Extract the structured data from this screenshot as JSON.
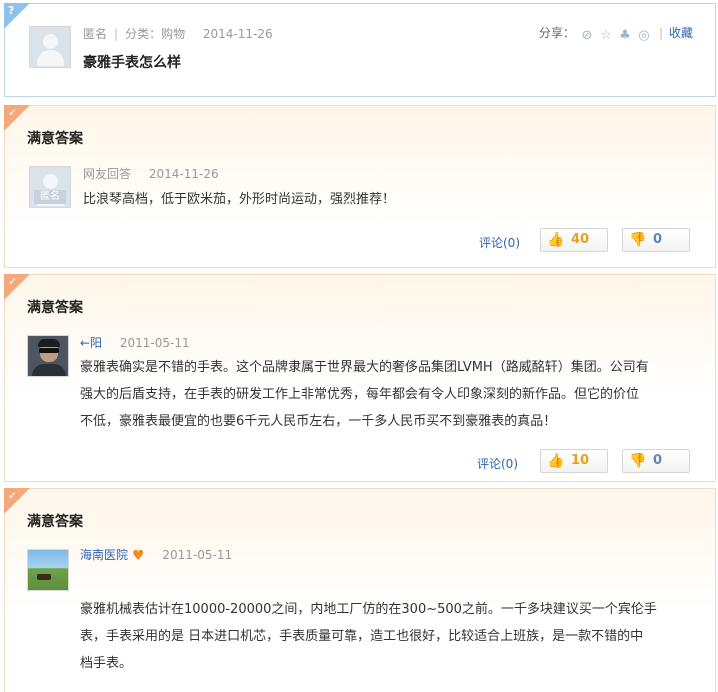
{
  "question": {
    "user": "匿名",
    "category": "分类：购物",
    "date": "2014-11-26",
    "title": "豪雅手表怎么样",
    "share_label": "分享：",
    "favorite_label": "收藏",
    "share_icons": [
      "search-icon",
      "star-icon",
      "user-icon",
      "weibo-icon"
    ]
  },
  "answers": [
    {
      "header": "满意答案",
      "user": "网友回答",
      "date": "2014-11-26",
      "avatar_tag": "匿名",
      "lines": [
        "比浪琴高档，低于欧米茄，外形时尚运动，强烈推荐！"
      ],
      "comment": "评论(0)",
      "up": "40",
      "down": "0"
    },
    {
      "header": "满意答案",
      "user": "←阳",
      "date": "2011-05-11",
      "lines": [
        "豪雅表确实是不错的手表。这个品牌隶属于世界最大的奢侈品集团LVMH（路威酩轩）集团。公司有",
        "强大的后盾支持，在手表的研发工作上非常优秀，每年都会有令人印象深刻的新作品。但它的价位",
        "不低，豪雅表最便宜的也要6千元人民币左右，一千多人民币买不到豪雅表的真品！"
      ],
      "comment": "评论(0)",
      "up": "10",
      "down": "0"
    },
    {
      "header": "满意答案",
      "user": "海南医院",
      "date": "2011-05-11",
      "lines": [
        "豪雅机械表估计在10000-20000之间，内地工厂仿的在300~500之前。一千多块建议买一个宾伦手",
        "表，手表采用的是 日本进口机芯，手表质量可靠，造工也很好，比较适合上班族，是一款不错的中",
        "档手表。"
      ]
    }
  ],
  "colors": {
    "link_blue": "#2d64b3",
    "question_corner": "#8ec2ea",
    "answer_corner": "#f4a97b",
    "vote_up": "#e6a021"
  }
}
